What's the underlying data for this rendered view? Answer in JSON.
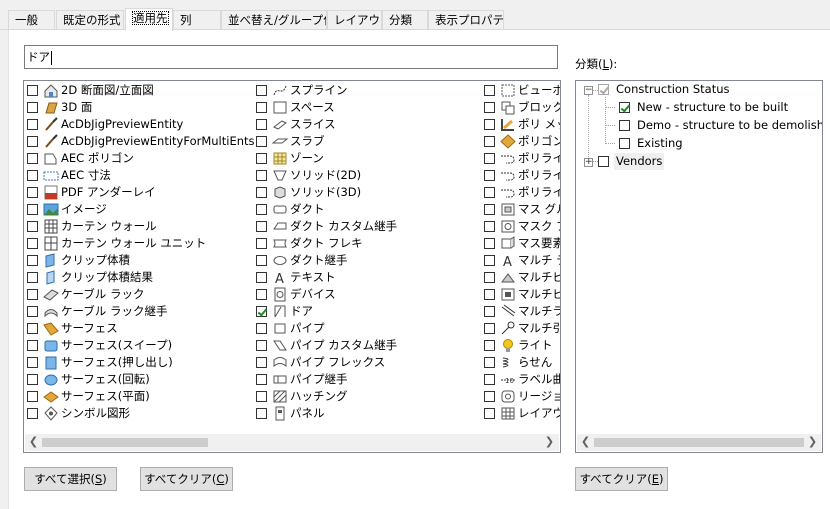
{
  "tabs": [
    {
      "label": "一般",
      "active": false
    },
    {
      "label": "既定の形式",
      "active": false
    },
    {
      "label": "適用先",
      "active": true
    },
    {
      "label": "列",
      "active": false
    },
    {
      "label": "並べ替え/グループ化",
      "active": false
    },
    {
      "label": "レイアウト",
      "active": false
    },
    {
      "label": "分類",
      "active": false
    },
    {
      "label": "表示プロパティ",
      "active": false
    }
  ],
  "search": {
    "value": "ドア"
  },
  "object_list": {
    "columns": [
      [
        {
          "label": "2D 断面図/立面図",
          "icon": "house-icon",
          "checked": false
        },
        {
          "label": "3D 面",
          "icon": "face-icon",
          "checked": false
        },
        {
          "label": "AcDbJigPreviewEntity",
          "icon": "brush-icon",
          "checked": false
        },
        {
          "label": "AcDbJigPreviewEntityForMultiEnts",
          "icon": "brush-icon",
          "checked": false
        },
        {
          "label": "AEC ポリゴン",
          "icon": "polygon-icon",
          "checked": false
        },
        {
          "label": "AEC 寸法",
          "icon": "dimension-icon",
          "checked": false
        },
        {
          "label": "PDF アンダーレイ",
          "icon": "pdf-icon",
          "checked": false
        },
        {
          "label": "イメージ",
          "icon": "image-icon",
          "checked": false
        },
        {
          "label": "カーテン ウォール",
          "icon": "curtain-wall-icon",
          "checked": false
        },
        {
          "label": "カーテン ウォール ユニット",
          "icon": "curtain-wall-unit-icon",
          "checked": false
        },
        {
          "label": "クリップ体積",
          "icon": "clip-volume-icon",
          "checked": false
        },
        {
          "label": "クリップ体積結果",
          "icon": "clip-result-icon",
          "checked": false
        },
        {
          "label": "ケーブル ラック",
          "icon": "cable-tray-icon",
          "checked": false
        },
        {
          "label": "ケーブル ラック継手",
          "icon": "cable-fitting-icon",
          "checked": false
        },
        {
          "label": "サーフェス",
          "icon": "surface-icon",
          "checked": false
        },
        {
          "label": "サーフェス(スイープ)",
          "icon": "surface-sweep-icon",
          "checked": false
        },
        {
          "label": "サーフェス(押し出し)",
          "icon": "surface-extrude-icon",
          "checked": false
        },
        {
          "label": "サーフェス(回転)",
          "icon": "surface-revolve-icon",
          "checked": false
        },
        {
          "label": "サーフェス(平面)",
          "icon": "surface-plane-icon",
          "checked": false
        },
        {
          "label": "シンボル図形",
          "icon": "symbol-icon",
          "checked": false
        }
      ],
      [
        {
          "label": "スプライン",
          "icon": "spline-icon",
          "checked": false
        },
        {
          "label": "スペース",
          "icon": "space-icon",
          "checked": false
        },
        {
          "label": "スライス",
          "icon": "slice-icon",
          "checked": false
        },
        {
          "label": "スラブ",
          "icon": "slab-icon",
          "checked": false
        },
        {
          "label": "ゾーン",
          "icon": "zone-icon",
          "checked": false
        },
        {
          "label": "ソリッド(2D)",
          "icon": "solid-2d-icon",
          "checked": false
        },
        {
          "label": "ソリッド(3D)",
          "icon": "solid-3d-icon",
          "checked": false
        },
        {
          "label": "ダクト",
          "icon": "duct-icon",
          "checked": false
        },
        {
          "label": "ダクト カスタム継手",
          "icon": "duct-custom-fitting-icon",
          "checked": false
        },
        {
          "label": "ダクト フレキ",
          "icon": "duct-flex-icon",
          "checked": false
        },
        {
          "label": "ダクト継手",
          "icon": "duct-fitting-icon",
          "checked": false
        },
        {
          "label": "テキスト",
          "icon": "text-icon",
          "checked": false
        },
        {
          "label": "デバイス",
          "icon": "device-icon",
          "checked": false
        },
        {
          "label": "ドア",
          "icon": "door-icon",
          "checked": true
        },
        {
          "label": "パイプ",
          "icon": "pipe-icon",
          "checked": false
        },
        {
          "label": "パイプ カスタム継手",
          "icon": "pipe-custom-fitting-icon",
          "checked": false
        },
        {
          "label": "パイプ フレックス",
          "icon": "pipe-flex-icon",
          "checked": false
        },
        {
          "label": "パイプ継手",
          "icon": "pipe-fitting-icon",
          "checked": false
        },
        {
          "label": "ハッチング",
          "icon": "hatch-icon",
          "checked": false
        },
        {
          "label": "パネル",
          "icon": "panel-icon",
          "checked": false
        }
      ],
      [
        {
          "label": "ビューポー",
          "icon": "viewport-icon",
          "checked": false
        },
        {
          "label": "ブロック参",
          "icon": "block-icon",
          "checked": false
        },
        {
          "label": "ポリ メッシ",
          "icon": "poly-mesh-icon",
          "checked": false
        },
        {
          "label": "ポリゴン",
          "icon": "polygon2-icon",
          "checked": false
        },
        {
          "label": "ポリライン",
          "icon": "polyline-icon",
          "checked": false
        },
        {
          "label": "ポリライン",
          "icon": "polyline-icon",
          "checked": false
        },
        {
          "label": "ポリライン",
          "icon": "polyline-icon",
          "checked": false
        },
        {
          "label": "マス グル",
          "icon": "mass-group-icon",
          "checked": false
        },
        {
          "label": "マスク ブ",
          "icon": "mask-icon",
          "checked": false
        },
        {
          "label": "マス要素",
          "icon": "mass-element-icon",
          "checked": false
        },
        {
          "label": "マルチ テ",
          "icon": "mtext-icon",
          "checked": false
        },
        {
          "label": "マルチビ",
          "icon": "multiview-icon",
          "checked": false
        },
        {
          "label": "マルチビ",
          "icon": "multiview-block-icon",
          "checked": false
        },
        {
          "label": "マルチライ",
          "icon": "mline-icon",
          "checked": false
        },
        {
          "label": "マルチ引",
          "icon": "mleader-icon",
          "checked": false
        },
        {
          "label": "ライト",
          "icon": "light-icon",
          "checked": false
        },
        {
          "label": "らせん",
          "icon": "helix-icon",
          "checked": false
        },
        {
          "label": "ラベル曲",
          "icon": "label-curve-icon",
          "checked": false
        },
        {
          "label": "リージョン",
          "icon": "region-icon",
          "checked": false
        },
        {
          "label": "レイアウ",
          "icon": "layout-grid-icon",
          "checked": false
        }
      ]
    ]
  },
  "buttons": {
    "select_all": {
      "text": "すべて選択(",
      "key": "S",
      "end": ")"
    },
    "clear_all_left": {
      "text": "すべてクリア(",
      "key": "C",
      "end": ")"
    },
    "clear_all_right": {
      "text": "すべてクリア(",
      "key": "E",
      "end": ")"
    }
  },
  "classification": {
    "label_text": "分類(",
    "label_key": "L",
    "label_end": "):",
    "tree": [
      {
        "label": "Construction Status",
        "checked": true,
        "disabled": true,
        "expanded": true,
        "children": [
          {
            "label": "New - structure to be built",
            "checked": true
          },
          {
            "label": "Demo - structure to be demolished",
            "checked": false
          },
          {
            "label": "Existing",
            "checked": false
          }
        ]
      },
      {
        "label": "Vendors",
        "checked": false,
        "expanded": false,
        "children": []
      }
    ]
  },
  "colors": {
    "check": "#1f8b1f",
    "border": "#828790",
    "button_bg": "#e1e1e1"
  }
}
